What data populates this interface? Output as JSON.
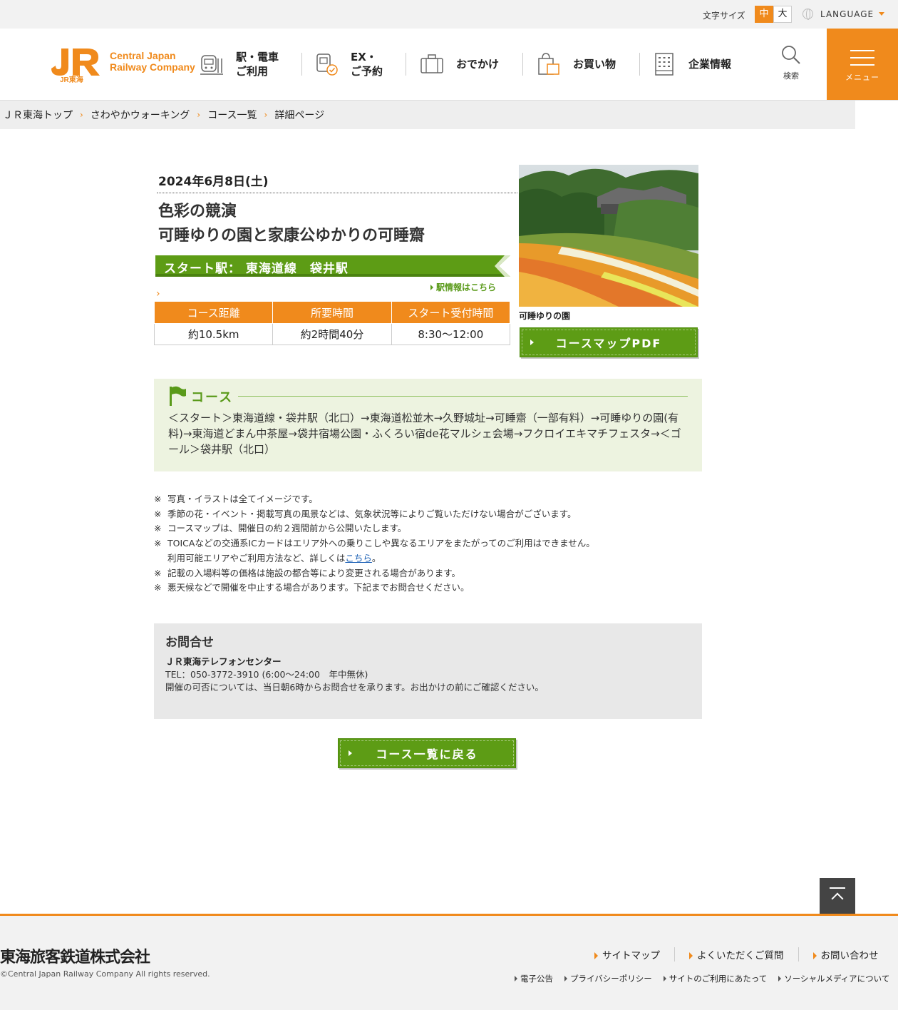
{
  "utility": {
    "font_size_label": "文字サイズ",
    "font_size_medium": "中",
    "font_size_large": "大",
    "language_label": "LANGUAGE"
  },
  "header": {
    "logo_line1": "Central Japan",
    "logo_line2": "Railway Company",
    "logo_sub": "JR東海",
    "nav": [
      {
        "label": "駅・電車\nご利用"
      },
      {
        "label": "EX・\nご予約"
      },
      {
        "label": "おでかけ"
      },
      {
        "label": "お買い物"
      },
      {
        "label": "企業情報"
      }
    ],
    "search_label": "検索",
    "menu_label": "メニュー"
  },
  "breadcrumb": [
    "ＪＲ東海トップ",
    "さわやかウォーキング",
    "コース一覧",
    "詳細ページ"
  ],
  "course": {
    "date": "2024年6月8日(土)",
    "title": "色彩の競演\n可睡ゆりの園と家康公ゆかりの可睡齋",
    "start_station": "スタート駅： 東海道線　袋井駅",
    "station_info_link": "駅情報はこちら",
    "table_headers": [
      "コース距離",
      "所要時間",
      "スタート受付時間"
    ],
    "table_values": [
      "約10.5km",
      "約2時間40分",
      "8:30～12:00"
    ],
    "photo_caption": "可睡ゆりの園",
    "pdf_button": "コースマップPDF",
    "course_heading": "コース",
    "course_route": "＜スタート＞東海道線・袋井駅（北口）→東海道松並木→久野城址→可睡齋（一部有料）→可睡ゆりの園(有料)→東海道どまん中茶屋→袋井宿場公園・ふくろい宿de花マルシェ会場→フクロイエキマチフェスタ→＜ゴール＞袋井駅（北口）"
  },
  "notes": {
    "mark": "※",
    "items": [
      "写真・イラストは全てイメージです。",
      "季節の花・イベント・掲載写真の風景などは、気象状況等によりご覧いただけない場合がございます。",
      "コースマップは、開催日の約２週間前から公開いたします。",
      "TOICAなどの交通系ICカードはエリア外への乗りこしや異なるエリアをまたがってのご利用はできません。",
      "記載の入場料等の価格は施設の都合等により変更される場合があります。",
      "悪天候などで開催を中止する場合があります。下記までお問合せください。"
    ],
    "ic_followup_prefix": "利用可能エリアやご利用方法など、詳しくは",
    "ic_followup_link": "こちら",
    "ic_followup_suffix": "。"
  },
  "contact": {
    "title": "お問合せ",
    "name": "ＪＲ東海テレフォンセンター",
    "tel": "TEL：050-3772-3910 (6:00～24:00　年中無休)",
    "note": "開催の可否については、当日朝6時からお問合せを承ります。お出かけの前にご確認ください。"
  },
  "back_button": "コース一覧に戻る",
  "footer": {
    "company": "東海旅客鉄道株式会社",
    "copyright": "©Central Japan Railway Company All rights reserved.",
    "links_main": [
      "サイトマップ",
      "よくいただくご質問",
      "お問い合わせ"
    ],
    "links_sub": [
      "電子公告",
      "プライバシーポリシー",
      "サイトのご利用にあたって",
      "ソーシャルメディアについて"
    ]
  },
  "colors": {
    "brand_orange": "#f08a1c",
    "green": "#5d9c15",
    "course_bg": "#edf3e0"
  }
}
